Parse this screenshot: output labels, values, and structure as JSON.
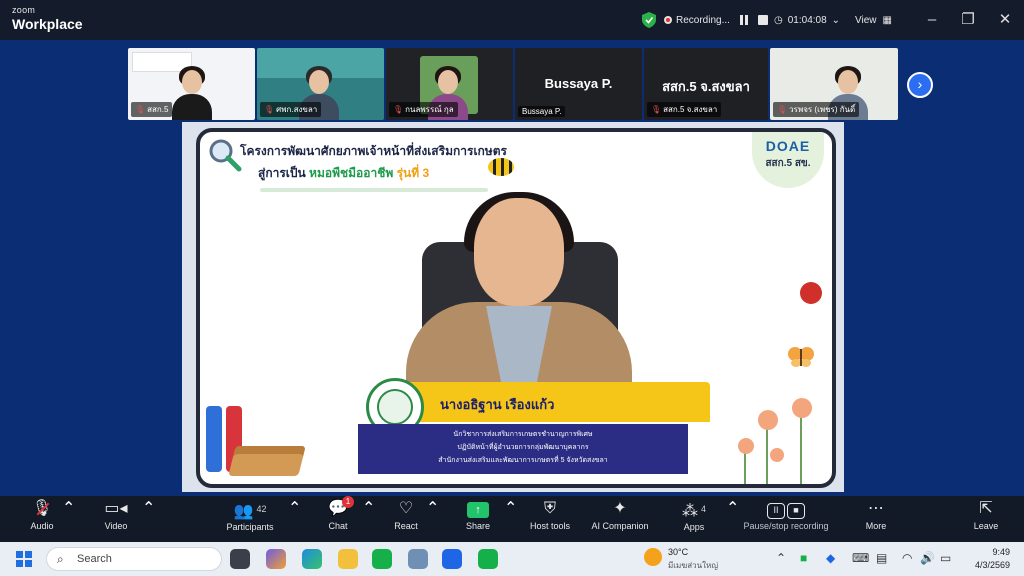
{
  "window": {
    "brand_small": "zoom",
    "brand_big": "Workplace",
    "recording_label": "Recording...",
    "timer": "01:04:08",
    "view_label": "View"
  },
  "participants": [
    {
      "name": "สสก.5",
      "muted": true
    },
    {
      "name": "ศพก.สงขลา",
      "muted": true
    },
    {
      "name": "กนลพรรณ์ กุล",
      "muted": true
    },
    {
      "name": "Bussaya P.",
      "display": "Bussaya P.",
      "muted": false
    },
    {
      "name": "สสก.5 จ.สงขลา",
      "display": "สสก.5 จ.สงขลา",
      "muted": true
    },
    {
      "name": "วรพจร (เพชร) กันดิ์",
      "muted": true
    }
  ],
  "slide": {
    "heading_line1": "โครงการพัฒนาศักยภาพเจ้าหน้าที่ส่งเสริมการเกษตร",
    "heading_line2_prefix": "สู่การเป็น",
    "heading_line2_green": "หมอพืชมืออาชีพ",
    "heading_line2_orange": "รุ่นที่ 3",
    "logo_text": "DOAE",
    "logo_office": "สสก.5 สข.",
    "speaker_name": "นางอธิฐาน เรืองแก้ว",
    "speaker_title_1": "นักวิชาการส่งเสริมการเกษตรชำนาญการพิเศษ",
    "speaker_title_2": "ปฏิบัติหน้าที่ผู้อำนวยการกลุ่มพัฒนาบุคลากร",
    "speaker_title_3": "สำนักงานส่งเสริมและพัฒนาการเกษตรที่ 5 จังหวัดสงขลา"
  },
  "toolbar": {
    "audio": "Audio",
    "video": "Video",
    "participants": "Participants",
    "participants_count": "42",
    "chat": "Chat",
    "chat_badge": "1",
    "react": "React",
    "share": "Share",
    "host_tools": "Host tools",
    "ai_companion": "AI Companion",
    "apps": "Apps",
    "apps_count": "4",
    "pause_stop_recording": "Pause/stop recording",
    "more": "More",
    "leave": "Leave"
  },
  "taskbar": {
    "search_placeholder": "Search",
    "weather_temp": "30°C",
    "weather_desc": "มีเมฆส่วนใหญ่",
    "time": "9:49",
    "date": "4/3/2569"
  },
  "colors": {
    "background": "#0b2d74",
    "accent_blue": "#2c6ef2",
    "share_green": "#23c36b",
    "leave_red": "#e0323b",
    "slide_gold": "#f5c518",
    "slide_navy": "#2b2c83"
  }
}
